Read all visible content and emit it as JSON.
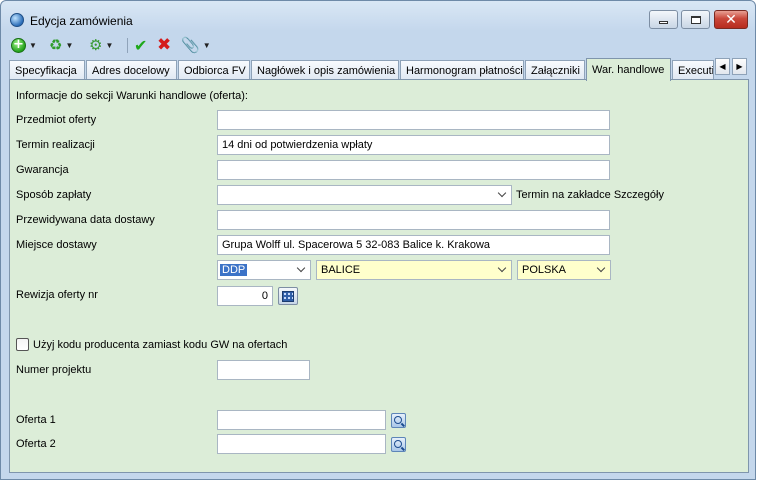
{
  "window": {
    "title": "Edycja zamówienia"
  },
  "tabs": [
    {
      "label": "Specyfikacja",
      "active": false
    },
    {
      "label": "Adres docelowy",
      "active": false
    },
    {
      "label": "Odbiorca FV",
      "active": false
    },
    {
      "label": "Nagłówek i opis zamówienia",
      "active": false
    },
    {
      "label": "Harmonogram płatności",
      "active": false
    },
    {
      "label": "Załączniki",
      "active": false
    },
    {
      "label": "War. handlowe",
      "active": true
    },
    {
      "label": "Executi",
      "active": false
    }
  ],
  "form": {
    "section_header": "Informacje do sekcji Warunki handlowe (oferta):",
    "przedmiot_label": "Przedmiot oferty",
    "przedmiot_value": "",
    "termin_label": "Termin realizacji",
    "termin_value": "14 dni od potwierdzenia wpłaty",
    "gwarancja_label": "Gwarancja",
    "gwarancja_value": "",
    "sposob_label": "Sposób zapłaty",
    "sposob_value": "",
    "sposob_note": "Termin na zakładce Szczegóły",
    "data_dostawy_label": "Przewidywana data dostawy",
    "data_dostawy_value": "",
    "miejsce_label": "Miejsce dostawy",
    "miejsce_value": "Grupa Wolff ul. Spacerowa 5 32-083 Balice k. Krakowa",
    "incoterm_value": "DDP",
    "city_value": "BALICE",
    "country_value": "POLSKA",
    "rewizja_label": "Rewizja oferty nr",
    "rewizja_value": "0",
    "checkbox_label": "Użyj kodu producenta zamiast kodu GW na ofertach",
    "checkbox_checked": false,
    "projekt_label": "Numer projektu",
    "projekt_value": "",
    "oferta1_label": "Oferta 1",
    "oferta1_value": "",
    "oferta2_label": "Oferta 2",
    "oferta2_value": ""
  },
  "colors": {
    "panel_bg": "#dcedd8",
    "yellow_field": "#ffffcc",
    "selection": "#3c73c7"
  }
}
